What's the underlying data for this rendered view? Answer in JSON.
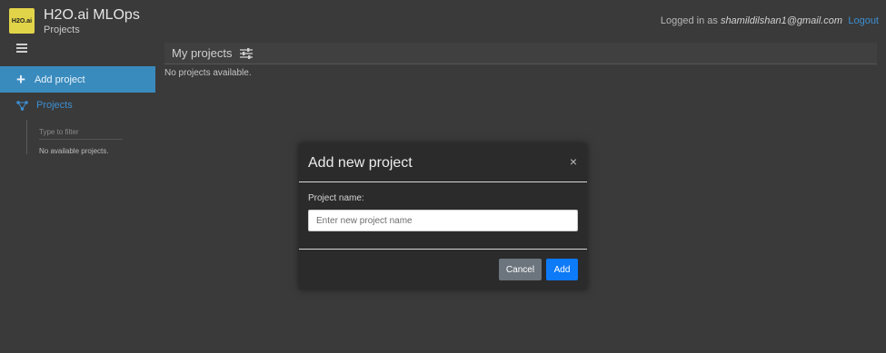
{
  "header": {
    "logo_text": "H2O.ai",
    "app_title": "H2O.ai MLOps",
    "app_subtitle": "Projects",
    "login_prefix": "Logged in as",
    "user_email": "shamildilshan1@gmail.com",
    "logout_label": "Logout"
  },
  "sidebar": {
    "menu_icon": "hamburger-icon",
    "add_project_label": "Add project",
    "add_project_icon": "plus-icon",
    "projects_label": "Projects",
    "projects_icon": "network-icon",
    "filter_placeholder": "Type to filter",
    "empty_text": "No available projects."
  },
  "main": {
    "title": "My projects",
    "title_icon": "sliders-icon",
    "empty_text": "No projects available."
  },
  "modal": {
    "title": "Add new project",
    "close_symbol": "×",
    "field_label": "Project name:",
    "input_placeholder": "Enter new project name",
    "input_value": "",
    "cancel_label": "Cancel",
    "add_label": "Add"
  },
  "colors": {
    "background": "#3a3a3a",
    "accent": "#3a8bbd",
    "link": "#3d8fd1",
    "primary_button": "#0d7af7",
    "secondary_button": "#6c757d",
    "logo": "#e2d449"
  }
}
